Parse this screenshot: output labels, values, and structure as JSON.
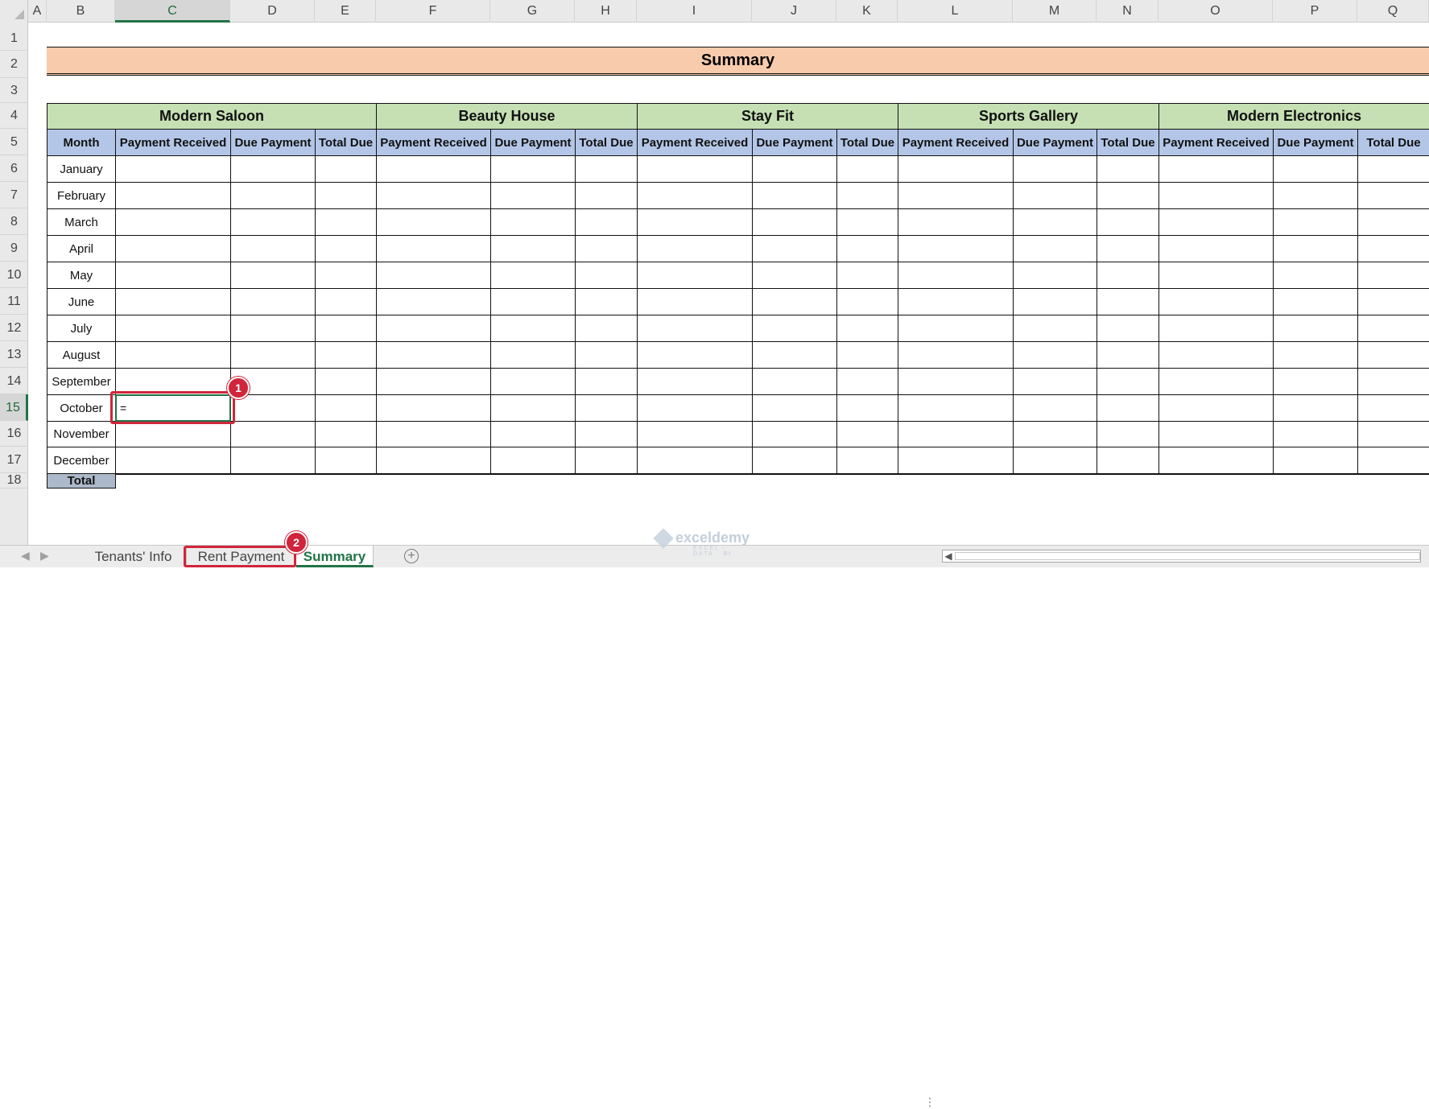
{
  "columns": [
    "A",
    "B",
    "C",
    "D",
    "E",
    "F",
    "G",
    "H",
    "I",
    "J",
    "K",
    "L",
    "M",
    "N",
    "O",
    "P",
    "Q"
  ],
  "active_column": "C",
  "rows": [
    "1",
    "2",
    "3",
    "4",
    "5",
    "6",
    "7",
    "8",
    "9",
    "10",
    "11",
    "12",
    "13",
    "14",
    "15",
    "16",
    "17",
    "18"
  ],
  "active_row": "15",
  "title": "Summary",
  "companies": [
    "Modern Saloon",
    "Beauty House",
    "Stay Fit",
    "Sports Gallery",
    "Modern Electronics"
  ],
  "month_header": "Month",
  "subheaders": [
    "Payment Received",
    "Due Payment",
    "Total Due"
  ],
  "months": [
    "January",
    "February",
    "March",
    "April",
    "May",
    "June",
    "July",
    "August",
    "September",
    "October",
    "November",
    "December"
  ],
  "total_label": "Total",
  "active_cell": {
    "ref": "C15",
    "value": "="
  },
  "callouts": [
    {
      "label": "1"
    },
    {
      "label": "2"
    }
  ],
  "tabs": [
    {
      "label": "Tenants' Info",
      "active": false
    },
    {
      "label": "Rent Payment",
      "active": false
    },
    {
      "label": "Summary",
      "active": true
    }
  ],
  "watermark": {
    "name": "exceldemy",
    "tagline": "EXCEL · DATA · BI"
  },
  "colors": {
    "title_band": "#f8cbad",
    "company": "#c6e0b4",
    "subheader": "#b4c6e7",
    "total": "#acb9ca",
    "accent": "#217346",
    "callout": "#d0253b"
  }
}
